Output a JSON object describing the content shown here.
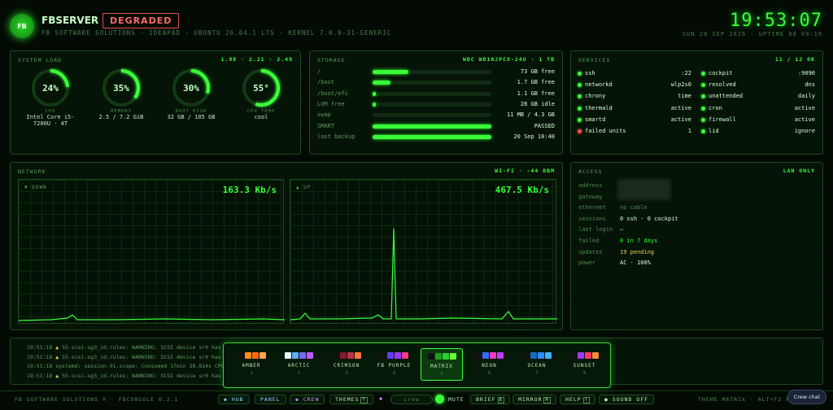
{
  "header": {
    "logo_text": "FB",
    "brand": "FBSERVER",
    "status": "DEGRADED",
    "subline": "FB SOFTWARE SOLUTIONS · IDEAPAD · UBUNTU 26.04.1 LTS · KERNEL 7.0.0-31-GENERIC",
    "clock": "19:53:07",
    "date": "SUN 20 SEP 2026 · UPTIME 0d 09:19"
  },
  "system": {
    "title": "SYSTEM LOAD",
    "load": "1.98 · 2.21 · 2.49",
    "gauges": [
      {
        "value_text": "24%",
        "fraction": 0.24,
        "label": "CPU",
        "sub": "Intel Core i5-7200U · 4T"
      },
      {
        "value_text": "35%",
        "fraction": 0.35,
        "label": "MEMORY",
        "sub": "2.5 / 7.2 GiB"
      },
      {
        "value_text": "30%",
        "fraction": 0.3,
        "label": "BOOT DISK",
        "sub": "32 GB / 105 GB"
      },
      {
        "value_text": "55°",
        "fraction": 0.55,
        "label": "CPU TEMP",
        "sub": "cool"
      }
    ]
  },
  "storage": {
    "title": "STORAGE",
    "device": "WDC WD10JPCX-24U · 1 TB",
    "rows": [
      {
        "label": "/",
        "fraction": 0.3,
        "value": "73 GB free"
      },
      {
        "label": "/boot",
        "fraction": 0.15,
        "value": "1.7 GB free"
      },
      {
        "label": "/boot/efi",
        "fraction": 0.02,
        "value": "1.1 GB free"
      },
      {
        "label": "LVM free",
        "fraction": 0.03,
        "value": "28 GB idle"
      },
      {
        "label": "swap",
        "fraction": 0.0,
        "value": "11 MB / 4.3 GB"
      },
      {
        "label": "SMART",
        "fraction": 1.0,
        "value": "PASSED"
      },
      {
        "label": "last backup",
        "fraction": 1.0,
        "value": "20 Sep 10:40"
      }
    ]
  },
  "services": {
    "title": "SERVICES",
    "summary": "11 / 12 OK",
    "items": [
      {
        "name": "ssh",
        "value": ":22",
        "ok": true
      },
      {
        "name": "cockpit",
        "value": ":9090",
        "ok": true
      },
      {
        "name": "networkd",
        "value": "wlp2s0",
        "ok": true
      },
      {
        "name": "resolved",
        "value": "dns",
        "ok": true
      },
      {
        "name": "chrony",
        "value": "time",
        "ok": true
      },
      {
        "name": "unattended",
        "value": "daily",
        "ok": true
      },
      {
        "name": "thermald",
        "value": "active",
        "ok": true
      },
      {
        "name": "cron",
        "value": "active",
        "ok": true
      },
      {
        "name": "smartd",
        "value": "active",
        "ok": true
      },
      {
        "name": "firewall",
        "value": "active",
        "ok": true
      },
      {
        "name": "failed units",
        "value": "1",
        "ok": false
      },
      {
        "name": "lid",
        "value": "ignore",
        "ok": true
      }
    ]
  },
  "network": {
    "title": "NETWORK",
    "wifi": "WI-FI · -44 DBM",
    "down_label": "▼ DOWN",
    "down_rate": "163.3 Kb/s",
    "up_label": "▲ UP",
    "up_rate": "467.5 Kb/s"
  },
  "access": {
    "title": "ACCESS",
    "scope": "LAN ONLY",
    "rows": [
      {
        "key": "address",
        "value": ""
      },
      {
        "key": "gateway",
        "value": ""
      },
      {
        "key": "ethernet",
        "value": "no cable"
      },
      {
        "key": "sessions",
        "value": "0 ssh · 0 cockpit"
      },
      {
        "key": "last login",
        "value": "—"
      },
      {
        "key": "failed",
        "value": "0 in 7 days"
      },
      {
        "key": "updates",
        "value": "19 pending"
      },
      {
        "key": "power",
        "value": "AC · 100%"
      }
    ]
  },
  "log": {
    "lines": [
      {
        "time": "19:51:18",
        "mark": "▲",
        "text": "55-scsi-sg3_id.rules: WARNING: SCSI device sr0 has"
      },
      {
        "time": "19:51:18",
        "mark": "▲",
        "text": "55-scsi-sg3_id.rules: WARNING: SCSI device sr0 has"
      },
      {
        "time": "19:51:18",
        "mark": "",
        "text": "systemd: session-91.scope: Consumed 17min 38.814s CPU"
      },
      {
        "time": "19:51:18",
        "mark": "▲",
        "text": "55-scsi-sg3_id.rules: WARNING: SCSI device sr0 has"
      }
    ]
  },
  "themes": [
    {
      "name": "AMBER",
      "num": "1",
      "colors": [
        "#111111",
        "#ff8c1a",
        "#ff6a1a",
        "#ffa54a"
      ],
      "active": false
    },
    {
      "name": "ARCTIC",
      "num": "2",
      "colors": [
        "#e8f4ff",
        "#5ab0ff",
        "#7a6aff",
        "#c05aff"
      ],
      "active": false
    },
    {
      "name": "CRIMSON",
      "num": "3",
      "colors": [
        "#111111",
        "#8a1a2a",
        "#c0304a",
        "#ff7a3a"
      ],
      "active": false
    },
    {
      "name": "FB PURPLE",
      "num": "4",
      "colors": [
        "#111111",
        "#6a3aff",
        "#9a3aff",
        "#ff3a8a"
      ],
      "active": false
    },
    {
      "name": "MATRIX",
      "num": "5",
      "colors": [
        "#111111",
        "#1aa01a",
        "#2ad02a",
        "#6aff3a"
      ],
      "active": true
    },
    {
      "name": "NEON",
      "num": "6",
      "colors": [
        "#111111",
        "#3a6aff",
        "#ff3ac0",
        "#c03aff"
      ],
      "active": false
    },
    {
      "name": "OCEAN",
      "num": "7",
      "colors": [
        "#111111",
        "#1a6ac0",
        "#2a8aff",
        "#4ab0ff"
      ],
      "active": false
    },
    {
      "name": "SUNSET",
      "num": "8",
      "colors": [
        "#111111",
        "#a03aff",
        "#ff3a6a",
        "#ff8a3a"
      ],
      "active": false
    }
  ],
  "footer": {
    "left": "FB SOFTWARE SOLUTIONS ® · FBCONSOLE 0.2.1",
    "hub": "◆ HUB",
    "panel": "PANEL",
    "crew": "◆ CREW",
    "themes": "THEMES",
    "themes_key": "T",
    "crew_toggle": "crew",
    "mute": "MUTE",
    "brief": "BRIEF",
    "brief_key": "B",
    "mirror": "MIRROR",
    "mirror_key": "M",
    "help": "HELP",
    "help_key": "?",
    "sound": "● SOUND OFF",
    "theme_status": "THEME MATRIX · ALT+F2 F",
    "crew_chat": "Crew chat"
  },
  "colors": {
    "accent": "#39ff39",
    "alert": "#ff4a4a",
    "warn": "#e6d05a"
  }
}
